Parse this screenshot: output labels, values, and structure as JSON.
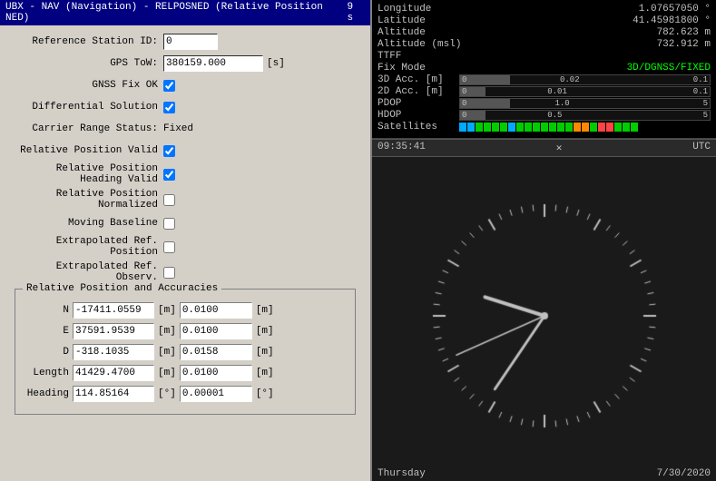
{
  "titleBar": {
    "text": "UBX - NAV (Navigation) - RELPOSNED (Relative Position NED)",
    "seconds": "9 s"
  },
  "form": {
    "referenceStationId": {
      "label": "Reference Station ID:",
      "value": "0"
    },
    "gpsToW": {
      "label": "GPS ToW:",
      "value": "380159.000",
      "unit": "[s]"
    },
    "gnssFixOk": {
      "label": "GNSS Fix OK",
      "checked": true
    },
    "differentialSolution": {
      "label": "Differential Solution",
      "checked": true
    },
    "carrierRangeStatus": {
      "label": "Carrier Range Status:",
      "value": "Fixed"
    },
    "relativePositionValid": {
      "label": "Relative Position Valid",
      "checked": true
    },
    "relativePositionHeadingValid": {
      "label": "Relative Position Heading Valid",
      "checked": true
    },
    "relativePositionNormalized": {
      "label": "Relative Position Normalized",
      "checked": false
    },
    "movingBaseline": {
      "label": "Moving Baseline",
      "checked": false
    },
    "extrapolatedRefPosition": {
      "label": "Extrapolated Ref. Position",
      "checked": false
    },
    "extrapolatedRefObserv": {
      "label": "Extrapolated Ref. Observ.",
      "checked": false
    }
  },
  "groupBox": {
    "title": "Relative Position and Accuracies",
    "rows": [
      {
        "label": "N",
        "value": "-17411.0559",
        "unit1": "[m]",
        "acc": "0.0100",
        "unit2": "[m]"
      },
      {
        "label": "E",
        "value": "37591.9539",
        "unit1": "[m]",
        "acc": "0.0100",
        "unit2": "[m]"
      },
      {
        "label": "D",
        "value": "-318.1035",
        "unit1": "[m]",
        "acc": "0.0158",
        "unit2": "[m]"
      }
    ],
    "lengthRow": {
      "label": "Length",
      "value": "41429.4700",
      "unit1": "[m]",
      "acc": "0.0100",
      "unit2": "[m]"
    },
    "headingRow": {
      "label": "Heading",
      "value": "114.85164",
      "unit1": "[°]",
      "acc": "0.00001",
      "unit2": "[°]"
    }
  },
  "gpsInfo": {
    "longitude": {
      "label": "Longitude",
      "value": "1.07657050 °"
    },
    "latitude": {
      "label": "Latitude",
      "value": "41.45981800 °"
    },
    "altitude": {
      "label": "Altitude",
      "value": "782.623 m"
    },
    "altitudeMsl": {
      "label": "Altitude (msl)",
      "value": "732.912 m"
    },
    "ttff": {
      "label": "TTFF",
      "value": ""
    },
    "fixMode": {
      "label": "Fix Mode",
      "value": "3D/DGNSS/FIXED"
    },
    "acc3d": {
      "label": "3D Acc. [m]",
      "value0": "0",
      "valueMid": "0.02",
      "valueRight": "0.1",
      "fillPct": 20
    },
    "acc2d": {
      "label": "2D Acc. [m]",
      "value0": "0",
      "valueMid": "0.01",
      "valueRight": "0.1",
      "fillPct": 10
    },
    "pdop": {
      "label": "PDOP",
      "value0": "0",
      "valueMid": "1.0",
      "valueRight": "5",
      "fillPct": 20
    },
    "hdop": {
      "label": "HDOP",
      "value0": "0",
      "valueMid": "0.5",
      "valueRight": "5",
      "fillPct": 10
    },
    "satellites": {
      "label": "Satellites",
      "colors": [
        "#00aaff",
        "#00aaff",
        "#00cc00",
        "#00cc00",
        "#00cc00",
        "#00cc00",
        "#00aaff",
        "#00cc00",
        "#00cc00",
        "#00cc00",
        "#00cc00",
        "#00cc00",
        "#00cc00",
        "#00cc00",
        "#ff8800",
        "#ff8800",
        "#00cc00",
        "#ff4444",
        "#ff4444",
        "#00cc00",
        "#00cc00",
        "#00cc00"
      ]
    }
  },
  "clock": {
    "time": "09:35:41",
    "timezone": "UTC",
    "day": "Thursday",
    "date": "7/30/2020"
  }
}
